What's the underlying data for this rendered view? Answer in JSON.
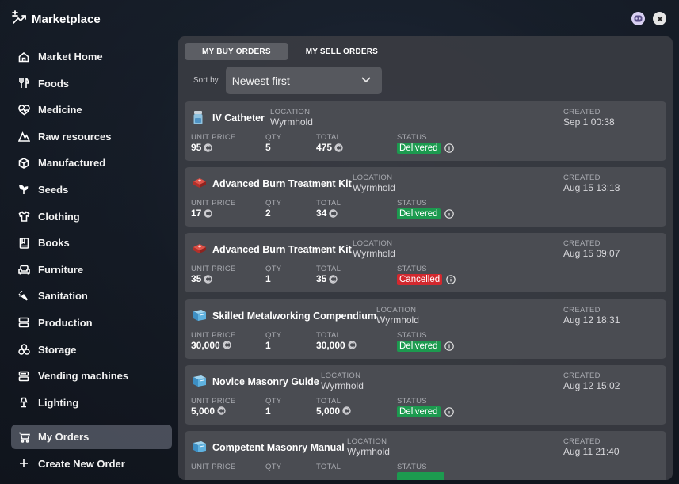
{
  "app": {
    "title": "Marketplace"
  },
  "sidebar": {
    "items": [
      {
        "label": "Market Home",
        "icon": "home-icon"
      },
      {
        "label": "Foods",
        "icon": "utensils-icon"
      },
      {
        "label": "Medicine",
        "icon": "heartbeat-icon"
      },
      {
        "label": "Raw resources",
        "icon": "mountain-icon"
      },
      {
        "label": "Manufactured",
        "icon": "cube-icon"
      },
      {
        "label": "Seeds",
        "icon": "sprout-icon"
      },
      {
        "label": "Clothing",
        "icon": "shirt-icon"
      },
      {
        "label": "Books",
        "icon": "book-icon"
      },
      {
        "label": "Furniture",
        "icon": "sofa-icon"
      },
      {
        "label": "Sanitation",
        "icon": "spray-icon"
      },
      {
        "label": "Production",
        "icon": "server-icon"
      },
      {
        "label": "Storage",
        "icon": "boxes-icon"
      },
      {
        "label": "Vending machines",
        "icon": "vending-icon"
      },
      {
        "label": "Lighting",
        "icon": "lamp-icon"
      }
    ],
    "my_orders": "My Orders",
    "create_order": "Create New Order"
  },
  "tabs": {
    "buy": "MY BUY ORDERS",
    "sell": "MY SELL ORDERS"
  },
  "sort": {
    "label": "Sort by",
    "value": "Newest first"
  },
  "captions": {
    "location": "LOCATION",
    "created": "CREATED",
    "unit_price": "UNIT PRICE",
    "qty": "QTY",
    "total": "TOTAL",
    "status": "STATUS"
  },
  "orders": [
    {
      "name": "IV Catheter",
      "icon": "vial-icon",
      "location": "Wyrmhold",
      "created": "Sep 1 00:38",
      "unit_price": "95",
      "qty": "5",
      "total": "475",
      "status": "Delivered"
    },
    {
      "name": "Advanced Burn Treatment Kit",
      "icon": "medkit-icon",
      "location": "Wyrmhold",
      "created": "Aug 15 13:18",
      "unit_price": "17",
      "qty": "2",
      "total": "34",
      "status": "Delivered"
    },
    {
      "name": "Advanced Burn Treatment Kit",
      "icon": "medkit-icon",
      "location": "Wyrmhold",
      "created": "Aug 15 09:07",
      "unit_price": "35",
      "qty": "1",
      "total": "35",
      "status": "Cancelled"
    },
    {
      "name": "Skilled Metalworking Compendium",
      "icon": "book-blue-icon",
      "location": "Wyrmhold",
      "created": "Aug 12 18:31",
      "unit_price": "30,000",
      "qty": "1",
      "total": "30,000",
      "status": "Delivered"
    },
    {
      "name": "Novice Masonry Guide",
      "icon": "book-blue-icon",
      "location": "Wyrmhold",
      "created": "Aug 12 15:02",
      "unit_price": "5,000",
      "qty": "1",
      "total": "5,000",
      "status": "Delivered"
    },
    {
      "name": "Competent Masonry Manual",
      "icon": "book-blue-icon",
      "location": "Wyrmhold",
      "created": "Aug 11 21:40",
      "unit_price": "",
      "qty": "",
      "total": "",
      "status": ""
    }
  ],
  "colors": {
    "delivered": "#1c9a4f",
    "cancelled": "#d3282e",
    "accent": "#ffffff"
  }
}
